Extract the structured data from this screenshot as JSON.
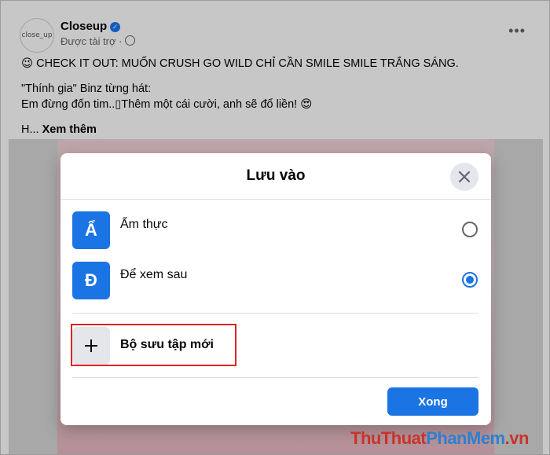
{
  "post": {
    "page_name": "Closeup",
    "avatar_text": "close_up",
    "sponsored": "Được tài trợ ·",
    "line1": "😉 CHECK IT OUT: MUỐN CRUSH GO WILD CHỈ CẦN SMILE SMILE TRẮNG SÁNG.",
    "line2": "\"Thính gia\" Binz từng hát:",
    "line3": "Em đừng đốn tim..▯Thêm một cái cười, anh sẽ đổ liền! 😍",
    "line4_prefix": "H...",
    "see_more": "Xem thêm"
  },
  "modal": {
    "title": "Lưu vào",
    "collections": [
      {
        "icon_letter": "Ẩ",
        "label": "Ẩm thực",
        "selected": false
      },
      {
        "icon_letter": "Đ",
        "label": "Để xem sau",
        "selected": true
      }
    ],
    "new_collection_label": "Bộ sưu tập mới",
    "done_label": "Xong"
  },
  "watermark": {
    "part1": "ThuThuat",
    "part2": "PhanMem",
    "part3": ".vn"
  },
  "colors": {
    "accent": "#1b74e4",
    "highlight": "#e0241f"
  }
}
